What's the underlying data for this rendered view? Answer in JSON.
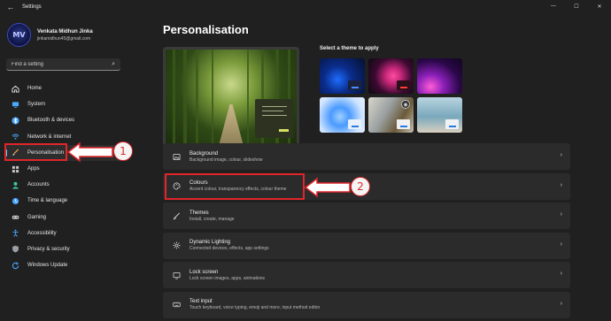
{
  "window": {
    "title": "Settings",
    "back_glyph": "←",
    "minimize_glyph": "—",
    "maximize_glyph": "☐",
    "close_glyph": "✕"
  },
  "profile": {
    "initials": "MV",
    "name": "Venkata Midhun Jinka",
    "email": "jinkamidhun45@gmail.com"
  },
  "search": {
    "placeholder": "Find a setting",
    "icon": "search-icon"
  },
  "sidebar": {
    "items": [
      {
        "label": "Home",
        "icon": "home-icon",
        "color": "#e8e8e8"
      },
      {
        "label": "System",
        "icon": "monitor-icon",
        "color": "#4aa8ff"
      },
      {
        "label": "Bluetooth & devices",
        "icon": "bluetooth-icon",
        "color": "#4aa8ff"
      },
      {
        "label": "Network & internet",
        "icon": "wifi-icon",
        "color": "#4aa8ff"
      },
      {
        "label": "Personalisation",
        "icon": "brush-icon",
        "color": "#f0a050",
        "active": true
      },
      {
        "label": "Apps",
        "icon": "apps-icon",
        "color": "#c8c8c8"
      },
      {
        "label": "Accounts",
        "icon": "person-icon",
        "color": "#3ec8a8"
      },
      {
        "label": "Time & language",
        "icon": "globe-clock-icon",
        "color": "#4aa8ff"
      },
      {
        "label": "Gaming",
        "icon": "gamepad-icon",
        "color": "#c8c8c8"
      },
      {
        "label": "Accessibility",
        "icon": "accessibility-icon",
        "color": "#4aa8ff"
      },
      {
        "label": "Privacy & security",
        "icon": "shield-icon",
        "color": "#9aa0a8"
      },
      {
        "label": "Windows Update",
        "icon": "update-icon",
        "color": "#4aa8ff"
      }
    ]
  },
  "main": {
    "title": "Personalisation",
    "themes_label": "Select a theme to apply",
    "themes": [
      "theme-1",
      "theme-2",
      "theme-3",
      "theme-4",
      "theme-5",
      "theme-6"
    ],
    "cards": [
      {
        "title": "Background",
        "subtitle": "Background image, colour, slideshow",
        "icon": "image-icon"
      },
      {
        "title": "Colours",
        "subtitle": "Accent colour, transparency effects, colour theme",
        "icon": "palette-icon"
      },
      {
        "title": "Themes",
        "subtitle": "Install, create, manage",
        "icon": "brush-icon"
      },
      {
        "title": "Dynamic Lighting",
        "subtitle": "Connected devices, effects, app settings",
        "icon": "light-icon"
      },
      {
        "title": "Lock screen",
        "subtitle": "Lock screen images, apps, animations",
        "icon": "lock-screen-icon"
      },
      {
        "title": "Text input",
        "subtitle": "Touch keyboard, voice typing, emoji and more, input method editor",
        "icon": "keyboard-icon"
      }
    ]
  },
  "annotations": {
    "step1": "1",
    "step2": "2",
    "color": "#e0262b"
  }
}
